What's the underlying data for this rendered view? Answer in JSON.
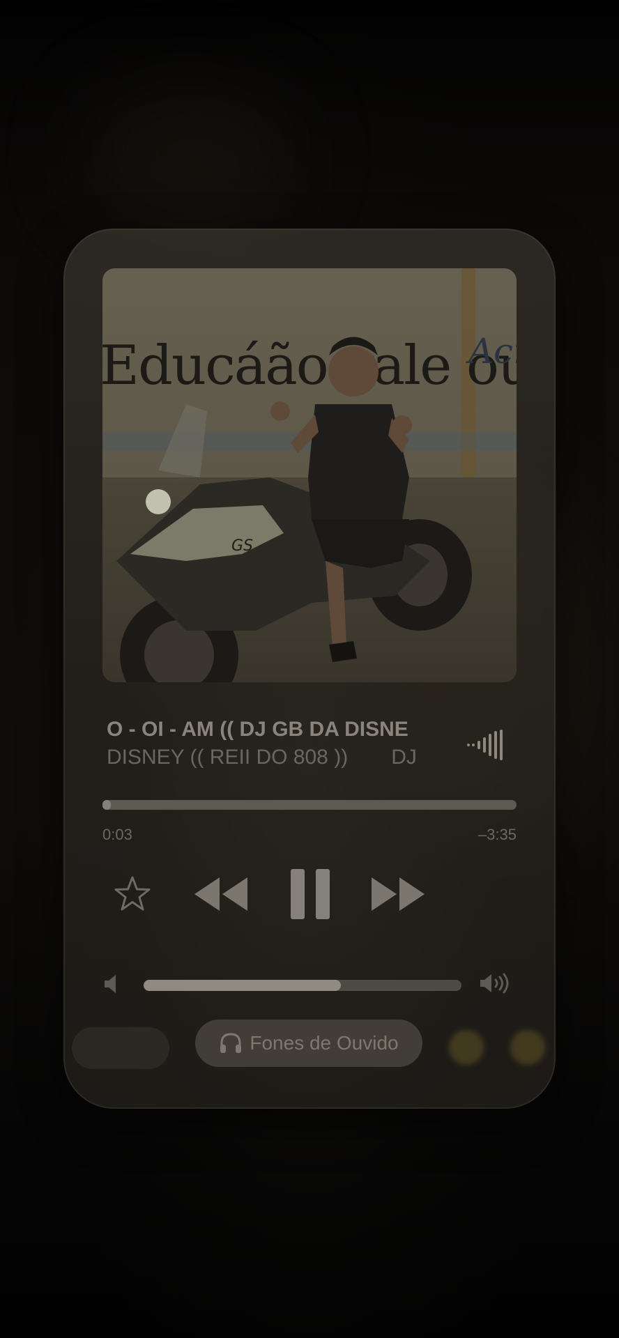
{
  "player": {
    "title": "O - OI - AM (( DJ GB DA DISNE",
    "artist": "DISNEY (( REII DO 808 ))",
    "artist_tail": "DJ",
    "artwork_caption": "Educáão vale ouro",
    "artwork_caption_2": "Acren",
    "progress": 0.015,
    "time_elapsed": "0:03",
    "time_remaining": "–3:35",
    "volume": 0.62,
    "output_device": "Fones de Ouvido",
    "colors": {
      "card": "#3a362f",
      "text_primary": "#8a857c",
      "text_secondary": "#6b665e",
      "accent": "#85817a"
    }
  },
  "icons": {
    "favorite": "star-icon",
    "previous": "rewind-icon",
    "play_state": "pause-icon",
    "next": "fast-forward-icon",
    "volume_low": "speaker-low-icon",
    "volume_high": "speaker-high-icon",
    "output": "headphones-icon",
    "live": "waveform-icon"
  }
}
